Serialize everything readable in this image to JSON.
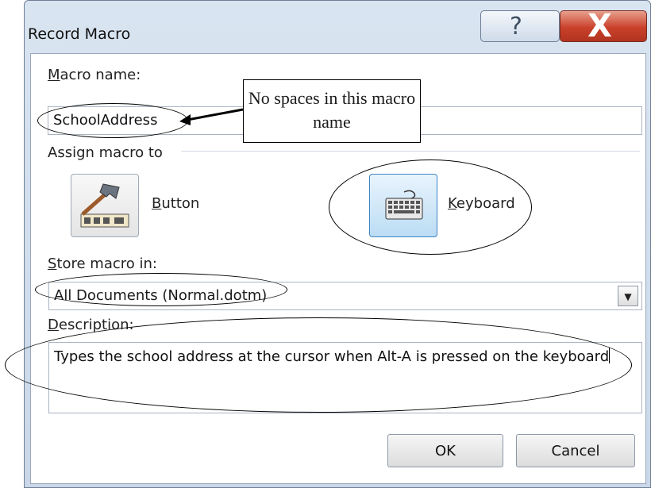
{
  "window": {
    "title": "Record Macro",
    "help_glyph": "?",
    "close_glyph": "X"
  },
  "macro_name": {
    "label": "Macro name:",
    "value": "SchoolAddress"
  },
  "assign": {
    "label": "Assign macro to",
    "button_label": "Button",
    "keyboard_label": "Keyboard",
    "button_icon": "hammer-toolbar-icon",
    "keyboard_icon": "keyboard-icon"
  },
  "store": {
    "label": "Store macro in:",
    "value": "All Documents (Normal.dotm)"
  },
  "description": {
    "label": "Description:",
    "value": "Types the school address at the cursor when Alt-A is pressed on the keyboard"
  },
  "actions": {
    "ok": "OK",
    "cancel": "Cancel"
  },
  "annotation": {
    "callout_text": "No spaces in this macro name"
  }
}
